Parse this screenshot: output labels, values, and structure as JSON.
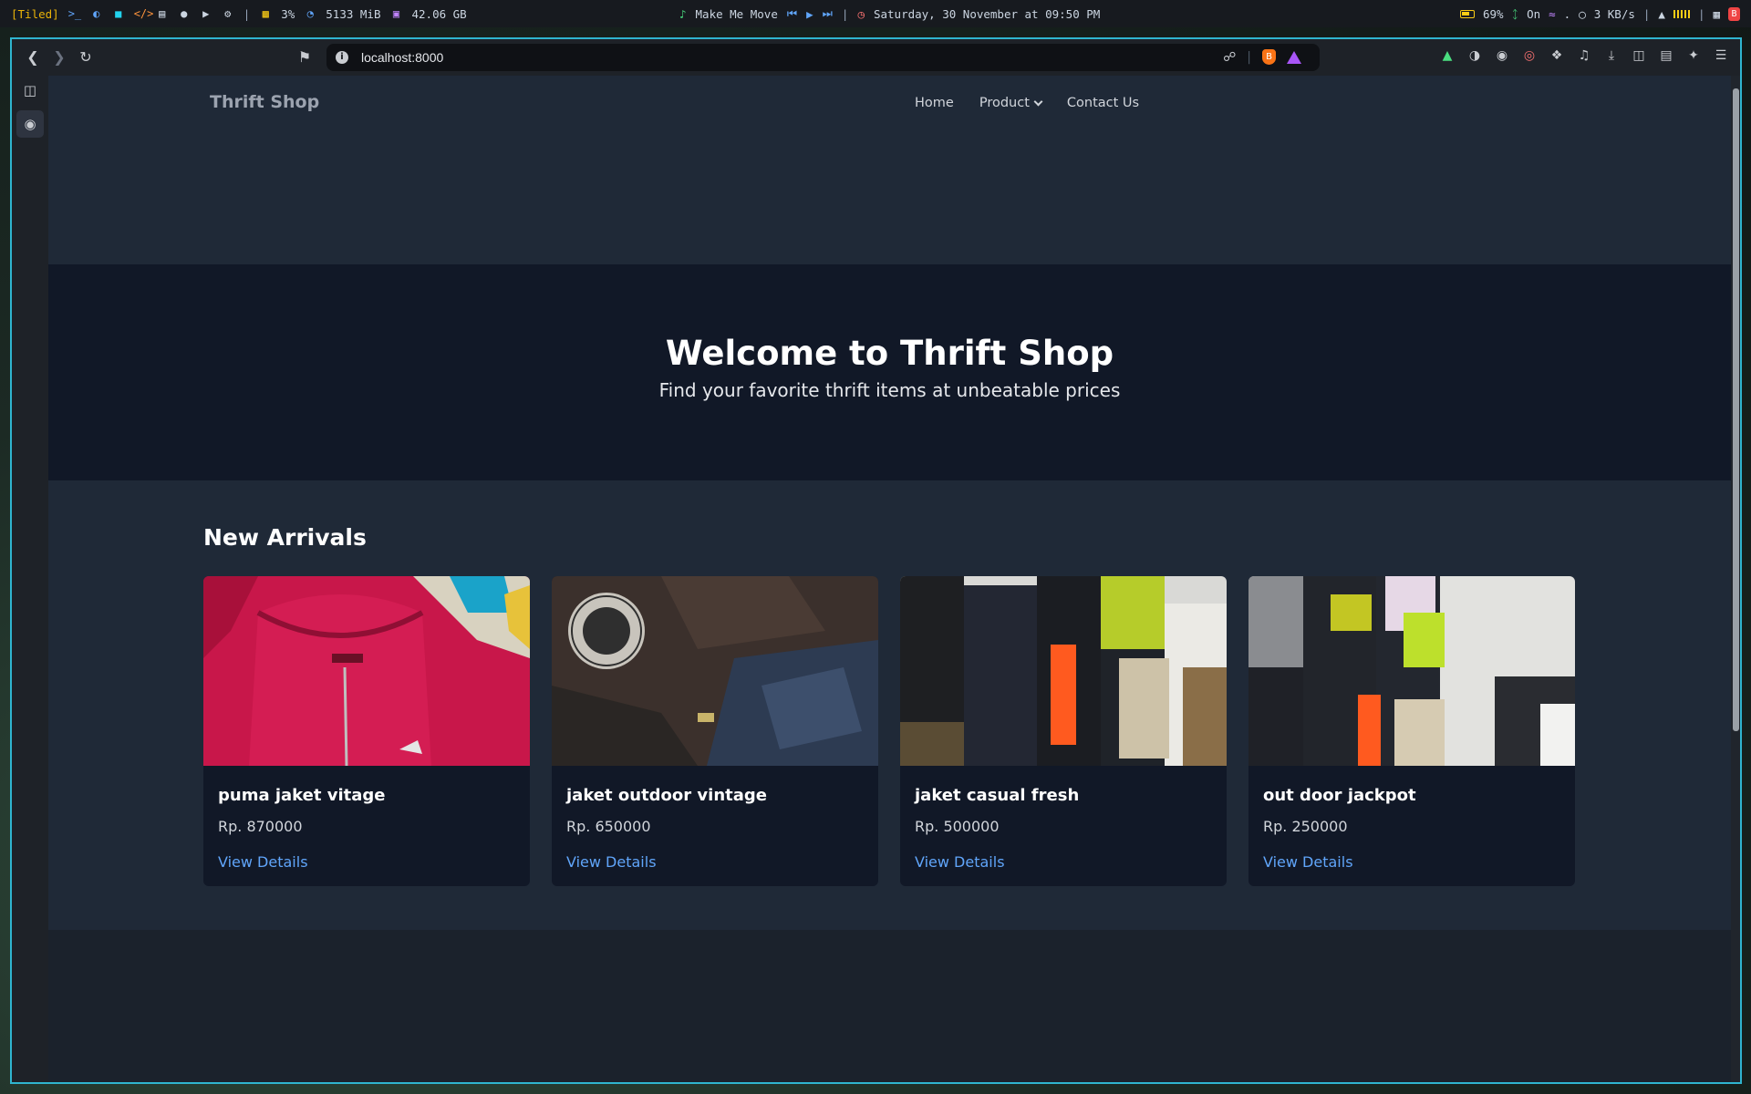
{
  "system_bar": {
    "workspace": "[Tiled]",
    "cpu": "3%",
    "memory": "5133 MiB",
    "disk": "42.06 GB",
    "music": "Make Me Move",
    "datetime": "Saturday, 30 November at 09:50 PM",
    "battery": "69%",
    "bluetooth": "On",
    "wifi": ".",
    "net_speed": "3 KB/s"
  },
  "browser": {
    "url": "localhost:8000"
  },
  "site": {
    "brand": "Thrift Shop",
    "nav": {
      "home": "Home",
      "product": "Product",
      "contact": "Contact Us"
    },
    "hero": {
      "title": "Welcome to Thrift Shop",
      "subtitle": "Find your favorite thrift items at unbeatable prices"
    },
    "arrivals": {
      "heading": "New Arrivals",
      "products": [
        {
          "name": "puma jaket vitage",
          "price": "Rp. 870000",
          "link": "View Details"
        },
        {
          "name": "jaket outdoor vintage",
          "price": "Rp. 650000",
          "link": "View Details"
        },
        {
          "name": "jaket casual fresh",
          "price": "Rp. 500000",
          "link": "View Details"
        },
        {
          "name": "out door jackpot",
          "price": "Rp. 250000",
          "link": "View Details"
        }
      ]
    }
  }
}
